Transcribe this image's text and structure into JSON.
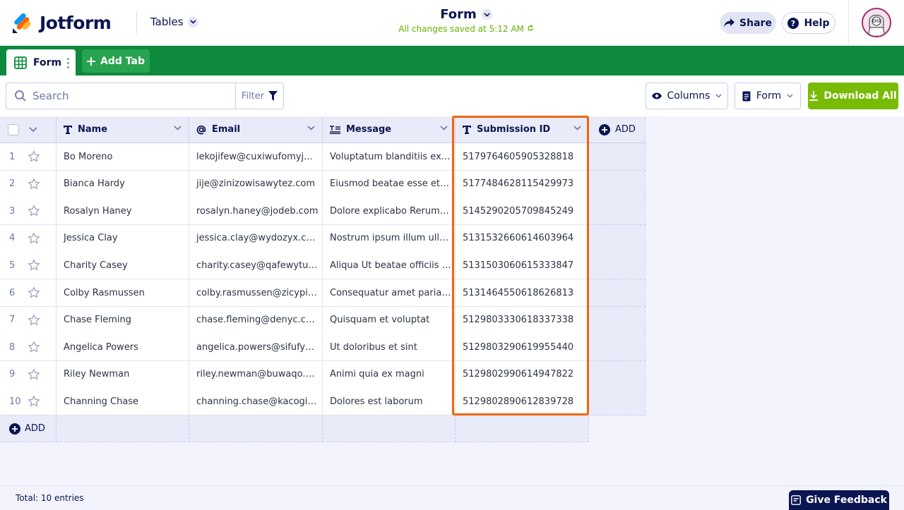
{
  "app": {
    "brand": "Jotform",
    "section_label": "Tables",
    "form_title": "Form",
    "saved_status": "All changes saved at 5:12 AM",
    "share_label": "Share",
    "help_label": "Help"
  },
  "tabs": {
    "active_label": "Form",
    "add_label": "Add Tab"
  },
  "toolbar": {
    "search_placeholder": "Search",
    "filter_label": "Filter",
    "columns_label": "Columns",
    "form_select_label": "Form",
    "download_label": "Download All"
  },
  "columns": [
    {
      "label": "Name",
      "icon": "text-type-icon"
    },
    {
      "label": "Email",
      "icon": "at-sign-icon"
    },
    {
      "label": "Message",
      "icon": "paragraph-icon"
    },
    {
      "label": "Submission ID",
      "icon": "text-type-icon"
    }
  ],
  "add_column_label": "ADD",
  "add_row_label": "ADD",
  "rows": [
    {
      "n": "1",
      "name": "Bo Moreno",
      "email": "lekojifew@cuxiwufomyje.c...",
      "message": "Voluptatum blanditiis exce...",
      "id": "5179764605905328818"
    },
    {
      "n": "2",
      "name": "Bianca Hardy",
      "email": "jije@zinizowisawytez.com",
      "message": "Eiusmod beatae esse et co...",
      "id": "5177484628115429973"
    },
    {
      "n": "3",
      "name": "Rosalyn Haney",
      "email": "rosalyn.haney@jodeb.com",
      "message": "Dolore explicabo Rerum n...",
      "id": "5145290205709845249"
    },
    {
      "n": "4",
      "name": "Jessica Clay",
      "email": "jessica.clay@wydozyx.com",
      "message": "Nostrum ipsum illum ullam...",
      "id": "5131532660614603964"
    },
    {
      "n": "5",
      "name": "Charity Casey",
      "email": "charity.casey@qafewytu.c...",
      "message": "Aliqua Ut beatae officiis vi...",
      "id": "5131503060615333847"
    },
    {
      "n": "6",
      "name": "Colby Rasmussen",
      "email": "colby.rasmussen@zicypiky...",
      "message": "Consequatur amet pariatu...",
      "id": "5131464550618626813"
    },
    {
      "n": "7",
      "name": "Chase Fleming",
      "email": "chase.fleming@denyc.com",
      "message": "Quisquam et voluptat",
      "id": "5129803330618337338"
    },
    {
      "n": "8",
      "name": "Angelica Powers",
      "email": "angelica.powers@sifufyxi...",
      "message": "Ut doloribus et sint",
      "id": "5129803290619955440"
    },
    {
      "n": "9",
      "name": "Riley Newman",
      "email": "riley.newman@buwaqo.com",
      "message": "Animi quia ex magni",
      "id": "5129802990614947822"
    },
    {
      "n": "10",
      "name": "Channing Chase",
      "email": "channing.chase@kacogitu...",
      "message": "Dolores est laborum",
      "id": "5129802890612839728"
    }
  ],
  "footer": {
    "total": "Total: 10 entries",
    "feedback_label": "Give Feedback"
  },
  "colors": {
    "brand_green": "#0d8a3d",
    "download_green": "#78bb07",
    "highlight_orange": "#f0650e",
    "navy": "#0a1551"
  }
}
